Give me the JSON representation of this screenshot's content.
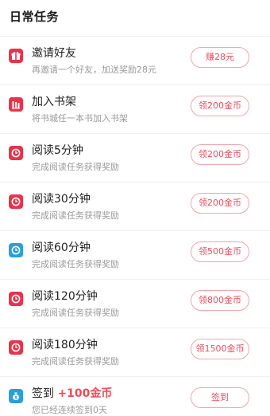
{
  "header": {
    "title": "日常任务"
  },
  "colors": {
    "red": "#e8334a",
    "blue": "#2a9fd8",
    "accent": "#ee4b5b"
  },
  "tasks": [
    {
      "icon": "gift-icon",
      "icon_color": "#e8334a",
      "title": "邀请好友",
      "reward": "",
      "desc": "再邀请一个好友，加送奖励28元",
      "button": "赚28元"
    },
    {
      "icon": "books-icon",
      "icon_color": "#e8334a",
      "title": "加入书架",
      "reward": "",
      "desc": "将书城任一本书加入书架",
      "button": "领200金币"
    },
    {
      "icon": "clock-icon",
      "icon_color": "#e8334a",
      "title": "阅读5分钟",
      "reward": "",
      "desc": "完成阅读任务获得奖励",
      "button": "领200金币"
    },
    {
      "icon": "clock-icon",
      "icon_color": "#e8334a",
      "title": "阅读30分钟",
      "reward": "",
      "desc": "完成阅读任务获得奖励",
      "button": "领200金币"
    },
    {
      "icon": "clock-icon",
      "icon_color": "#2a9fd8",
      "title": "阅读60分钟",
      "reward": "",
      "desc": "完成阅读任务获得奖励",
      "button": "领500金币"
    },
    {
      "icon": "clock-icon",
      "icon_color": "#e8334a",
      "title": "阅读120分钟",
      "reward": "",
      "desc": "完成阅读任务获得奖励",
      "button": "领800金币"
    },
    {
      "icon": "clock-icon",
      "icon_color": "#e8334a",
      "title": "阅读180分钟",
      "reward": "",
      "desc": "完成阅读任务获得奖励",
      "button": "领1500金币"
    },
    {
      "icon": "money-bag-icon",
      "icon_color": "#2a9fd8",
      "title": "签到",
      "reward": "+100金币",
      "desc": "您已经连续签到0天",
      "button": "签到"
    }
  ]
}
